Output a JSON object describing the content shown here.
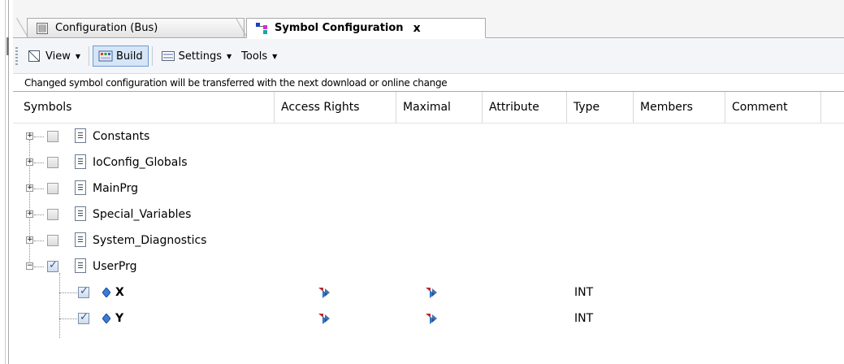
{
  "tabs": [
    {
      "label": "Configuration (Bus)",
      "icon": "bus-config-icon",
      "active": false
    },
    {
      "label": "Symbol Configuration",
      "icon": "symbol-config-icon",
      "active": true,
      "close": "x"
    }
  ],
  "toolbar": {
    "view_label": "View",
    "build_label": "Build",
    "settings_label": "Settings",
    "tools_label": "Tools"
  },
  "info_text": "Changed symbol configuration will be transferred with the next download or online change",
  "columns": [
    "Symbols",
    "Access Rights",
    "Maximal",
    "Attribute",
    "Type",
    "Members",
    "Comment"
  ],
  "rows": [
    {
      "name": "Constants",
      "checked": false,
      "expanded": false,
      "level": 0
    },
    {
      "name": "IoConfig_Globals",
      "checked": false,
      "expanded": false,
      "level": 0
    },
    {
      "name": "MainPrg",
      "checked": false,
      "expanded": false,
      "level": 0
    },
    {
      "name": "Special_Variables",
      "checked": false,
      "expanded": false,
      "level": 0
    },
    {
      "name": "System_Diagnostics",
      "checked": false,
      "expanded": false,
      "level": 0
    },
    {
      "name": "UserPrg",
      "checked": true,
      "expanded": true,
      "level": 0
    },
    {
      "name": "X",
      "checked": true,
      "level": 1,
      "access_rights": "read-write-icon",
      "maximal": "read-write-icon",
      "type": "INT"
    },
    {
      "name": "Y",
      "checked": true,
      "level": 1,
      "access_rights": "read-write-icon",
      "maximal": "read-write-icon",
      "type": "INT"
    }
  ],
  "colors": {
    "accent": "#d6e6f7",
    "border": "#a9a9a9"
  }
}
